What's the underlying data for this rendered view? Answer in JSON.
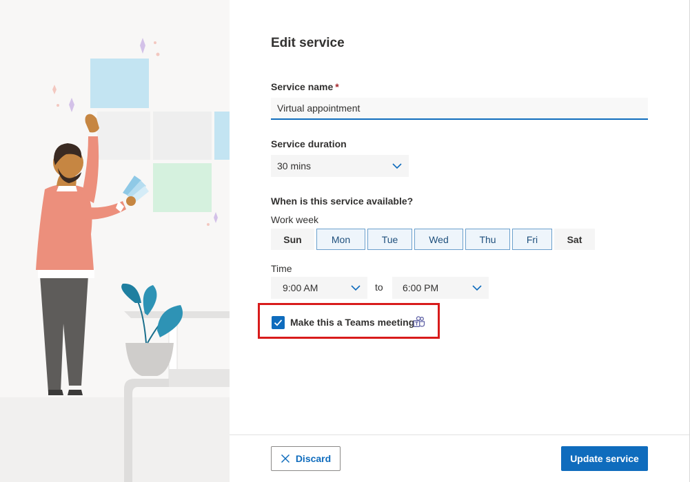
{
  "form": {
    "title": "Edit service",
    "service_name": {
      "label": "Service name",
      "required_mark": "*",
      "value": "Virtual appointment"
    },
    "service_duration": {
      "label": "Service duration",
      "selected": "30 mins"
    },
    "availability": {
      "label": "When is this service available?",
      "workweek_label": "Work week",
      "days": [
        {
          "label": "Sun",
          "selected": false
        },
        {
          "label": "Mon",
          "selected": true
        },
        {
          "label": "Tue",
          "selected": true
        },
        {
          "label": "Wed",
          "selected": true
        },
        {
          "label": "Thu",
          "selected": true
        },
        {
          "label": "Fri",
          "selected": true
        },
        {
          "label": "Sat",
          "selected": false
        }
      ],
      "time_label": "Time",
      "start_time": "9:00 AM",
      "to_label": "to",
      "end_time": "6:00 PM"
    },
    "teams": {
      "label": "Make this a Teams meeting",
      "checked": true,
      "icon": "teams-icon"
    }
  },
  "footer": {
    "discard_label": "Discard",
    "update_label": "Update service"
  },
  "colors": {
    "accent": "#0f6cbd",
    "highlight_border": "#d81b1b",
    "required": "#a4262c"
  }
}
